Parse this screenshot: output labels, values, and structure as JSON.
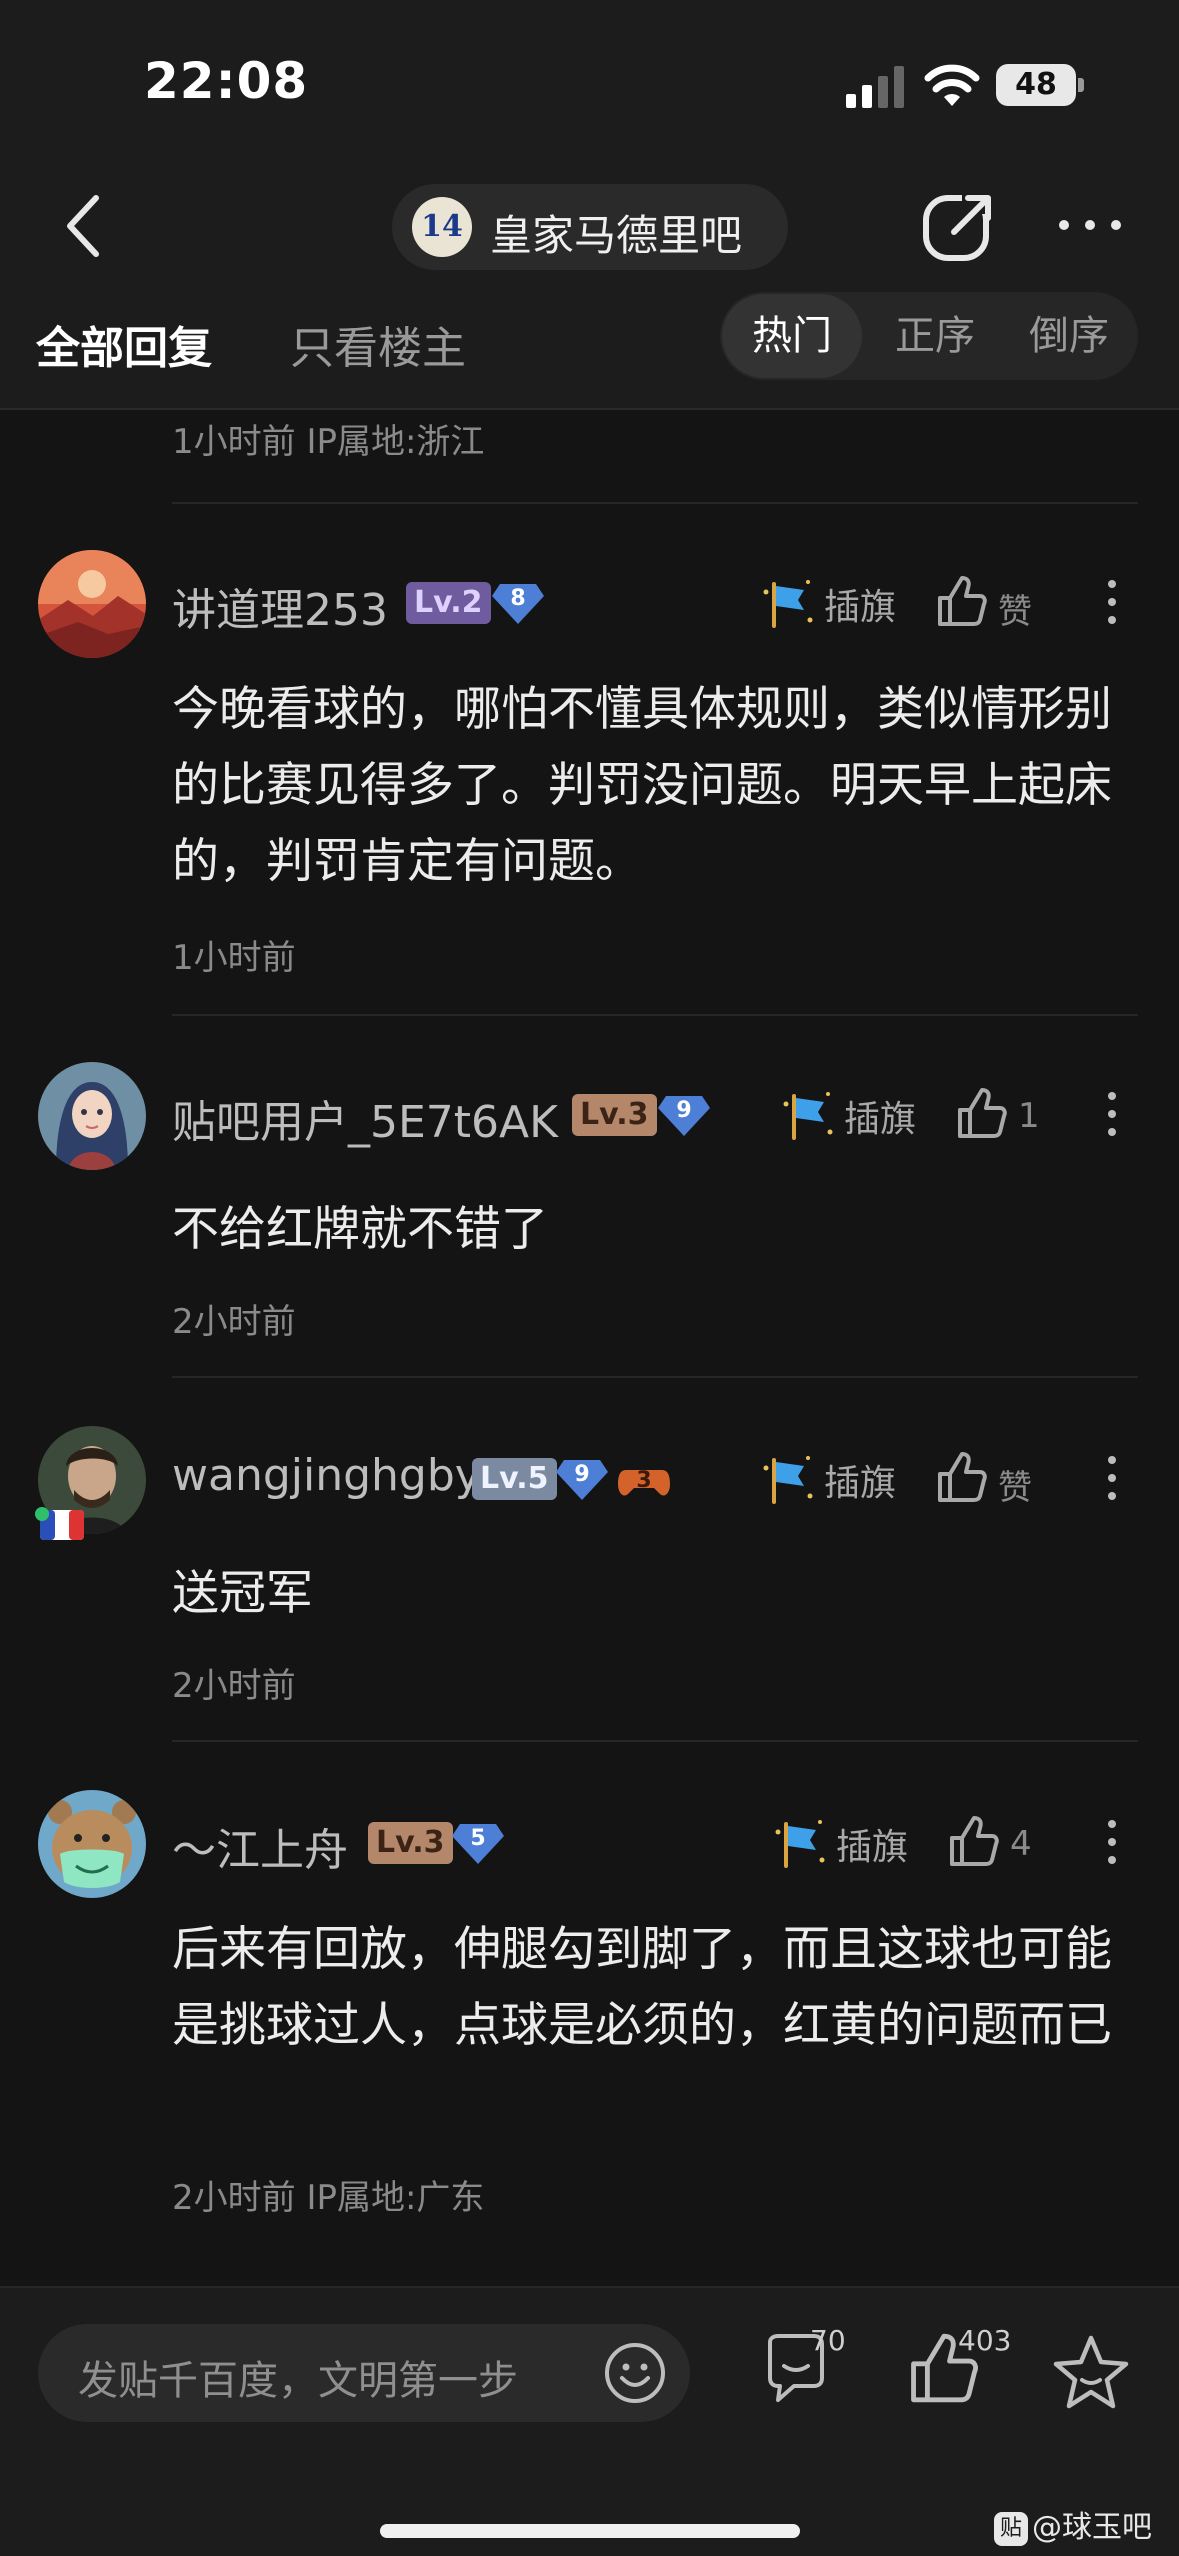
{
  "status_bar": {
    "time": "22:08",
    "battery": "48"
  },
  "nav": {
    "forum_badge": "14",
    "forum_name": "皇家马德里吧"
  },
  "filter": {
    "tab_all": "全部回复",
    "tab_host": "只看楼主",
    "sort_hot": "热门",
    "sort_asc": "正序",
    "sort_desc": "倒序"
  },
  "top_meta": "1小时前   IP属地:浙江",
  "comments": [
    {
      "username": "讲道理253",
      "level": "Lv.2",
      "gem": "8",
      "flag_label": "插旗",
      "like_label": "赞",
      "text": "今晚看球的，哪怕不懂具体规则，类似情形别的比赛见得多了。判罚没问题。明天早上起床的，判罚肯定有问题。",
      "meta": "1小时前"
    },
    {
      "username": "贴吧用户_5E7t6AK",
      "level": "Lv.3",
      "gem": "9",
      "flag_label": "插旗",
      "like_label": "1",
      "text": "不给红牌就不错了",
      "meta": "2小时前"
    },
    {
      "username": "wangjinghgby",
      "level": "Lv.5",
      "gem": "9",
      "extra_badge": "3",
      "flag_label": "插旗",
      "like_label": "赞",
      "text": "送冠军",
      "meta": "2小时前"
    },
    {
      "username": "～江上舟",
      "level": "Lv.3",
      "gem": "5",
      "flag_label": "插旗",
      "like_label": "4",
      "text": "后来有回放，伸腿勾到脚了，而且这球也可能是挑球过人，点球是必须的，红黄的问题而已",
      "meta": "2小时前   IP属地:广东"
    }
  ],
  "bottom_bar": {
    "input_placeholder": "发贴千百度，文明第一步",
    "reply_count": "70",
    "like_count": "403",
    "watermark": "@球玉吧",
    "watermark_logo": "贴"
  },
  "colors": {
    "background": "#141414",
    "bar": "#1c1c1c",
    "gem": "#4d7fd6",
    "flag": "#3da0e8"
  }
}
